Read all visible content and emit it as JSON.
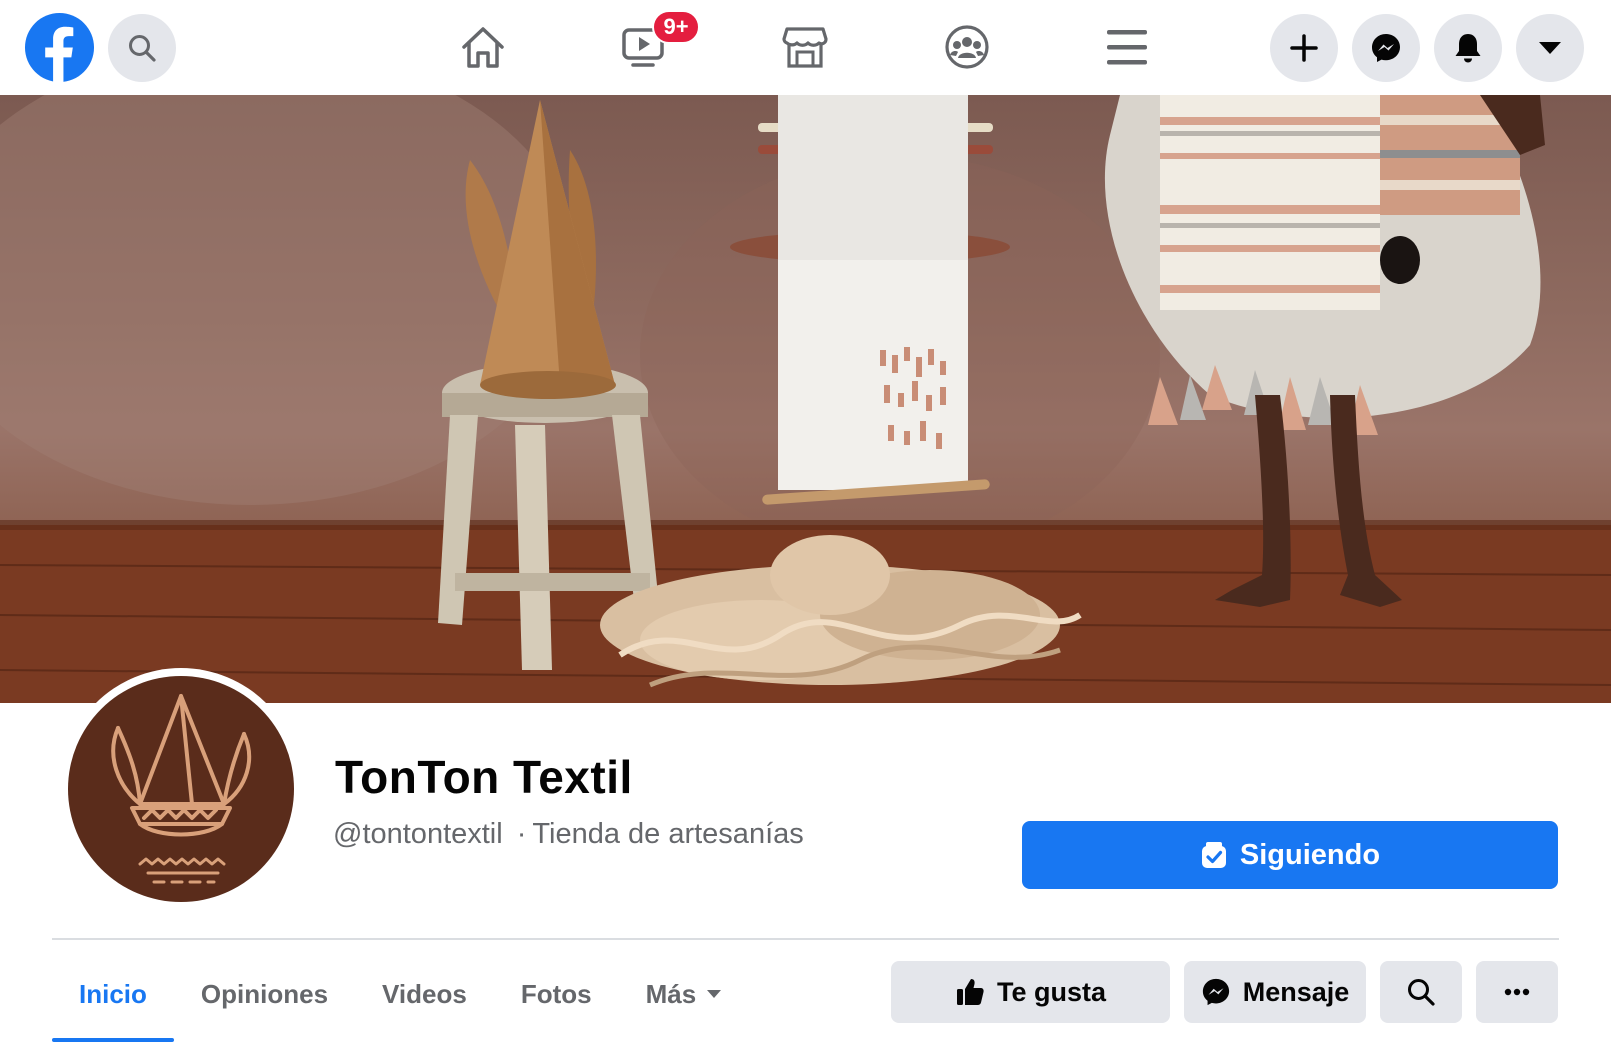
{
  "topbar": {
    "notifications_badge": "9+",
    "icons": {
      "logo": "facebook-logo",
      "search": "search-icon",
      "home": "home-icon",
      "watch": "video-icon",
      "marketplace": "store-icon",
      "groups": "groups-icon",
      "menu": "hamburger-icon",
      "create": "plus-icon",
      "messenger": "messenger-icon",
      "notifications": "bell-icon",
      "account": "caret-down-icon"
    }
  },
  "page": {
    "name": "TonTon Textil",
    "handle": "@tontontextil",
    "separator": "·",
    "category": "Tienda de artesanías",
    "follow_label": "Siguiendo"
  },
  "tabs": [
    {
      "label": "Inicio",
      "active": true
    },
    {
      "label": "Opiniones",
      "active": false
    },
    {
      "label": "Videos",
      "active": false
    },
    {
      "label": "Fotos",
      "active": false
    },
    {
      "label": "Más",
      "active": false
    }
  ],
  "actions": {
    "like_label": "Te gusta",
    "message_label": "Mensaje"
  },
  "colors": {
    "brand_blue": "#1877f2",
    "badge_red": "#e41e3f",
    "button_grey": "#e4e6eb",
    "avatar_brown": "#5a2c1b"
  }
}
